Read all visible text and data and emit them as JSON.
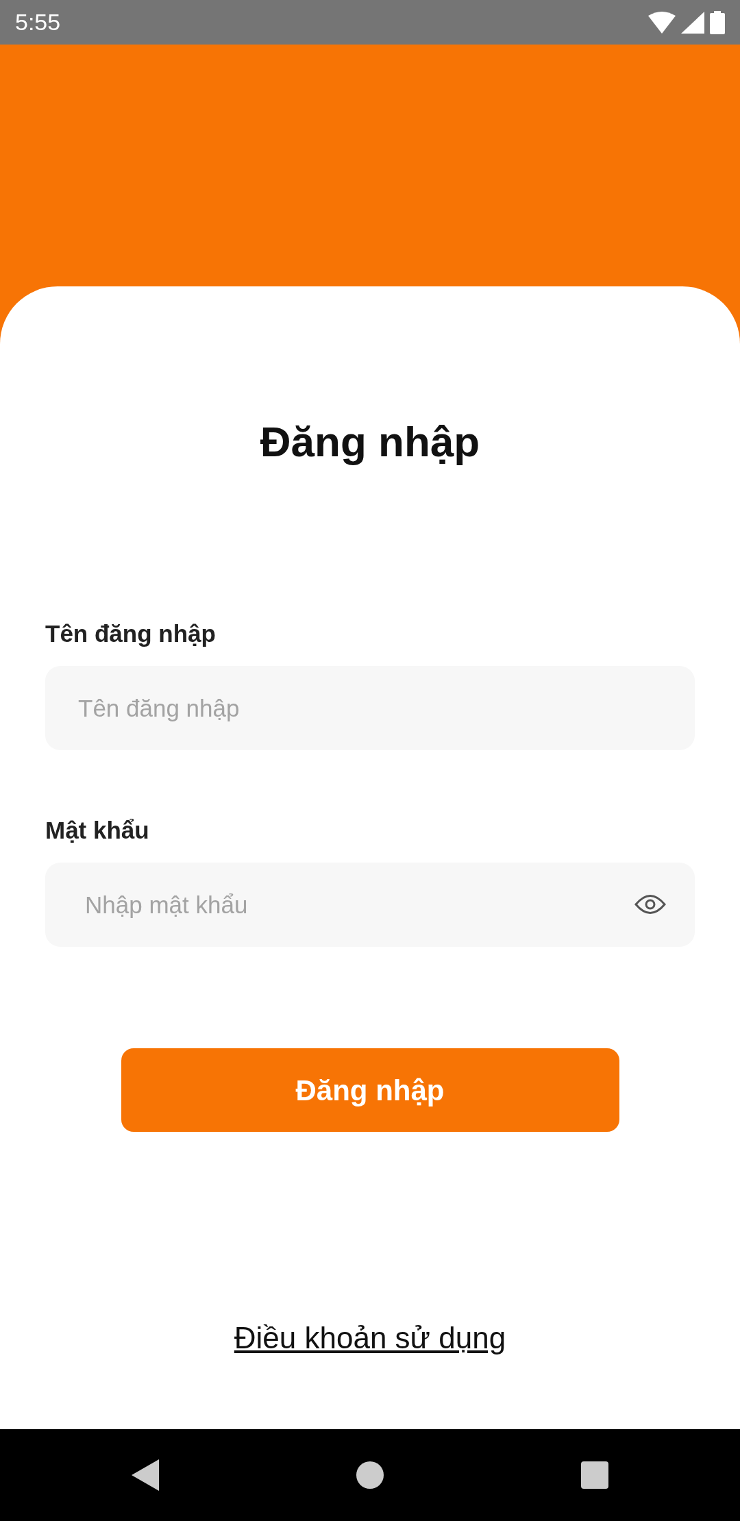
{
  "status_bar": {
    "time": "5:55"
  },
  "title": "Đăng nhập",
  "fields": [
    {
      "label": "Tên đăng nhập",
      "placeholder": "Tên đăng nhập",
      "kind": "text"
    },
    {
      "label": "Mật khẩu",
      "placeholder": "Nhập mật khẩu",
      "kind": "password"
    }
  ],
  "submit_button": "Đăng nhập",
  "terms_link": "Điều khoản sử dụng"
}
